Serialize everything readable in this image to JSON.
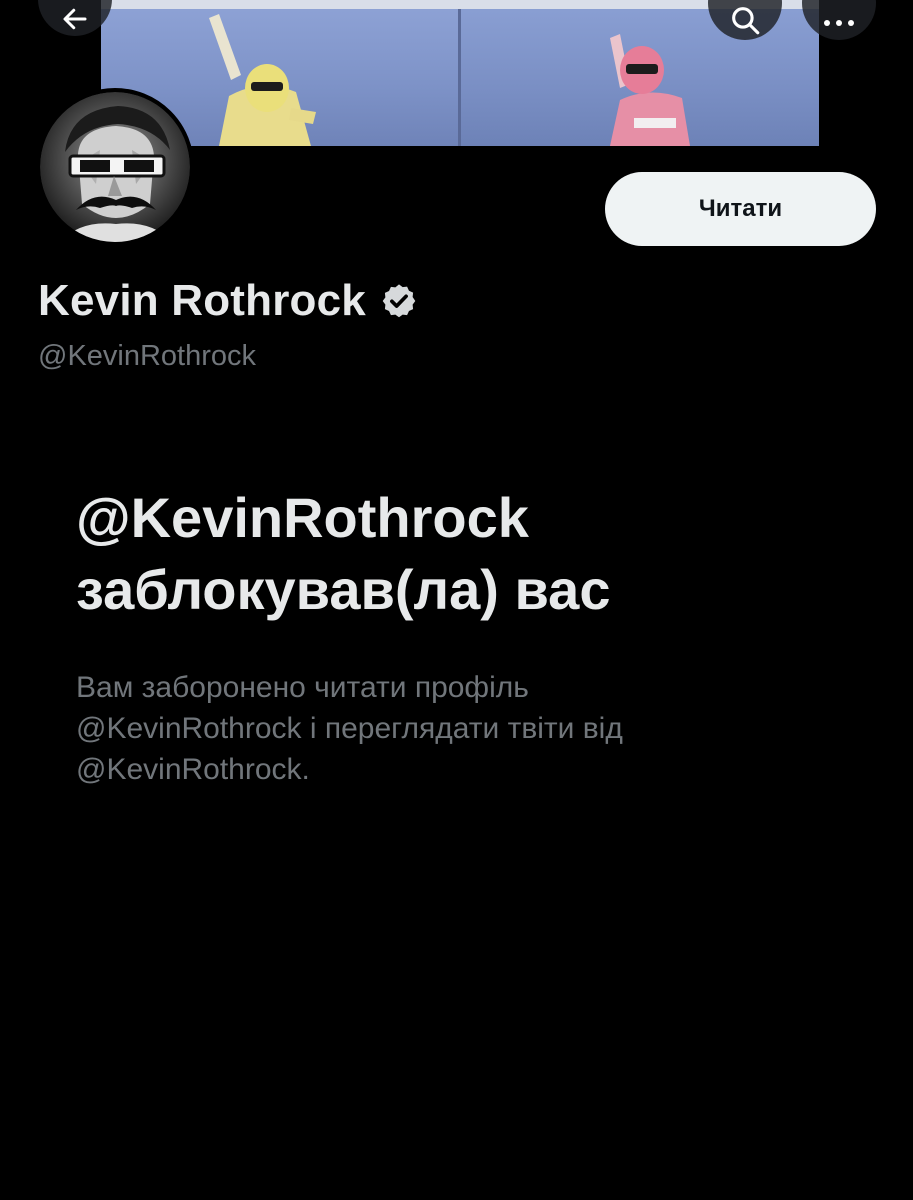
{
  "nav": {
    "back_icon": "arrow-left-icon",
    "search_icon": "search-icon",
    "more_icon": "more-horizontal-icon"
  },
  "profile": {
    "display_name": "Kevin Rothrock",
    "verified_icon": "verified-badge-icon",
    "handle": "@KevinRothrock",
    "follow_label": "Читати"
  },
  "blocked": {
    "title_line1": "@KevinRothrock",
    "title_line2": "заблокував(ла) вас",
    "desc_line1": "Вам заборонено читати профіль",
    "desc_line2": "@KevinRothrock і переглядати твіти від",
    "desc_line3": "@KevinRothrock."
  },
  "colors": {
    "background": "#000000",
    "primary_text": "#e7e9ea",
    "secondary_text": "#71767b",
    "button_bg": "#eff3f4",
    "button_text": "#0f1419"
  }
}
